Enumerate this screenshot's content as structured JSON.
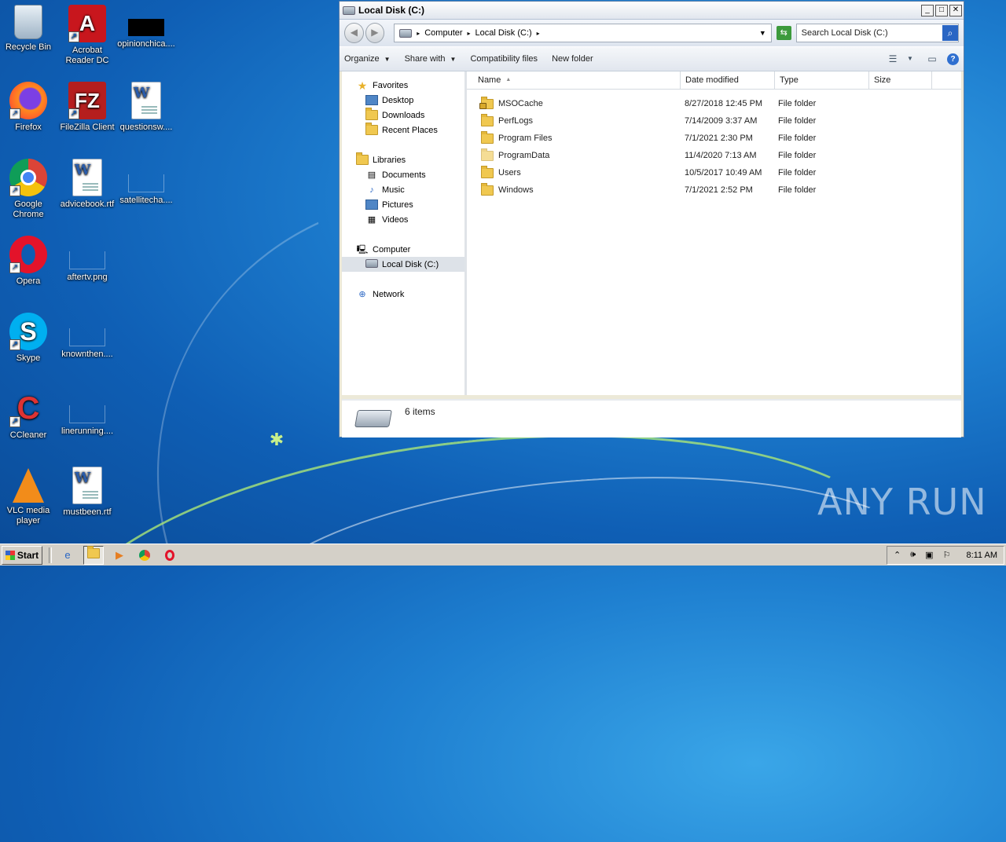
{
  "desktop": {
    "icons": [
      {
        "label": "Recycle Bin",
        "icon": "recycle-bin-icon"
      },
      {
        "label": "Acrobat Reader DC",
        "icon": "acrobat-icon"
      },
      {
        "label": "opinionchica....",
        "icon": "image-file-icon"
      },
      {
        "label": "Firefox",
        "icon": "firefox-icon"
      },
      {
        "label": "FileZilla Client",
        "icon": "filezilla-icon"
      },
      {
        "label": "questionsw....",
        "icon": "word-document-icon"
      },
      {
        "label": "Google Chrome",
        "icon": "chrome-icon"
      },
      {
        "label": "advicebook.rtf",
        "icon": "word-document-icon"
      },
      {
        "label": "satellitecha....",
        "icon": "image-file-icon"
      },
      {
        "label": "Opera",
        "icon": "opera-icon"
      },
      {
        "label": "aftertv.png",
        "icon": "image-file-icon"
      },
      {
        "label": "Skype",
        "icon": "skype-icon"
      },
      {
        "label": "knownthen....",
        "icon": "image-file-icon"
      },
      {
        "label": "CCleaner",
        "icon": "ccleaner-icon"
      },
      {
        "label": "linerunning....",
        "icon": "image-file-icon"
      },
      {
        "label": "VLC media player",
        "icon": "vlc-icon"
      },
      {
        "label": "mustbeen.rtf",
        "icon": "word-document-icon"
      }
    ],
    "watermark": "ANY RUN"
  },
  "window": {
    "title": "Local Disk (C:)",
    "address": {
      "parts": [
        "Computer",
        "Local Disk (C:)"
      ]
    },
    "search_placeholder": "Search Local Disk (C:)",
    "toolbar": {
      "organize": "Organize",
      "share_with": "Share with",
      "compatibility": "Compatibility files",
      "new_folder": "New folder"
    },
    "nav": {
      "favorites": "Favorites",
      "favorites_items": [
        "Desktop",
        "Downloads",
        "Recent Places"
      ],
      "libraries": "Libraries",
      "libraries_items": [
        "Documents",
        "Music",
        "Pictures",
        "Videos"
      ],
      "computer": "Computer",
      "computer_items": [
        "Local Disk (C:)"
      ],
      "network": "Network"
    },
    "columns": {
      "name": "Name",
      "date": "Date modified",
      "type": "Type",
      "size": "Size"
    },
    "files": [
      {
        "name": "MSOCache",
        "date": "8/27/2018 12:45 PM",
        "type": "File folder"
      },
      {
        "name": "PerfLogs",
        "date": "7/14/2009 3:37 AM",
        "type": "File folder"
      },
      {
        "name": "Program Files",
        "date": "7/1/2021 2:30 PM",
        "type": "File folder"
      },
      {
        "name": "ProgramData",
        "date": "11/4/2020 7:13 AM",
        "type": "File folder"
      },
      {
        "name": "Users",
        "date": "10/5/2017 10:49 AM",
        "type": "File folder"
      },
      {
        "name": "Windows",
        "date": "7/1/2021 2:52 PM",
        "type": "File folder"
      }
    ],
    "status": "6 items"
  },
  "taskbar": {
    "start": "Start",
    "clock": "8:11 AM"
  }
}
